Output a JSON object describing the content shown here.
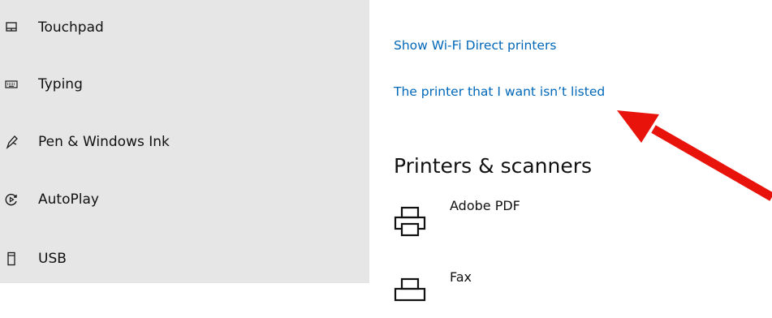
{
  "sidebar": {
    "items": [
      {
        "label": "Touchpad",
        "icon": "touchpad-icon"
      },
      {
        "label": "Typing",
        "icon": "keyboard-icon"
      },
      {
        "label": "Pen & Windows Ink",
        "icon": "pen-icon"
      },
      {
        "label": "AutoPlay",
        "icon": "autoplay-icon"
      },
      {
        "label": "USB",
        "icon": "usb-icon"
      }
    ]
  },
  "main": {
    "links": {
      "wifi_direct": "Show Wi-Fi Direct printers",
      "not_listed": "The printer that I want isn’t listed"
    },
    "section_title": "Printers & scanners",
    "devices": [
      {
        "label": "Adobe PDF",
        "icon": "printer-icon"
      },
      {
        "label": "Fax",
        "icon": "fax-icon"
      }
    ]
  },
  "colors": {
    "sidebar_bg": "#e6e6e6",
    "link": "#0067b8",
    "annotation_arrow": "#e8140c"
  }
}
